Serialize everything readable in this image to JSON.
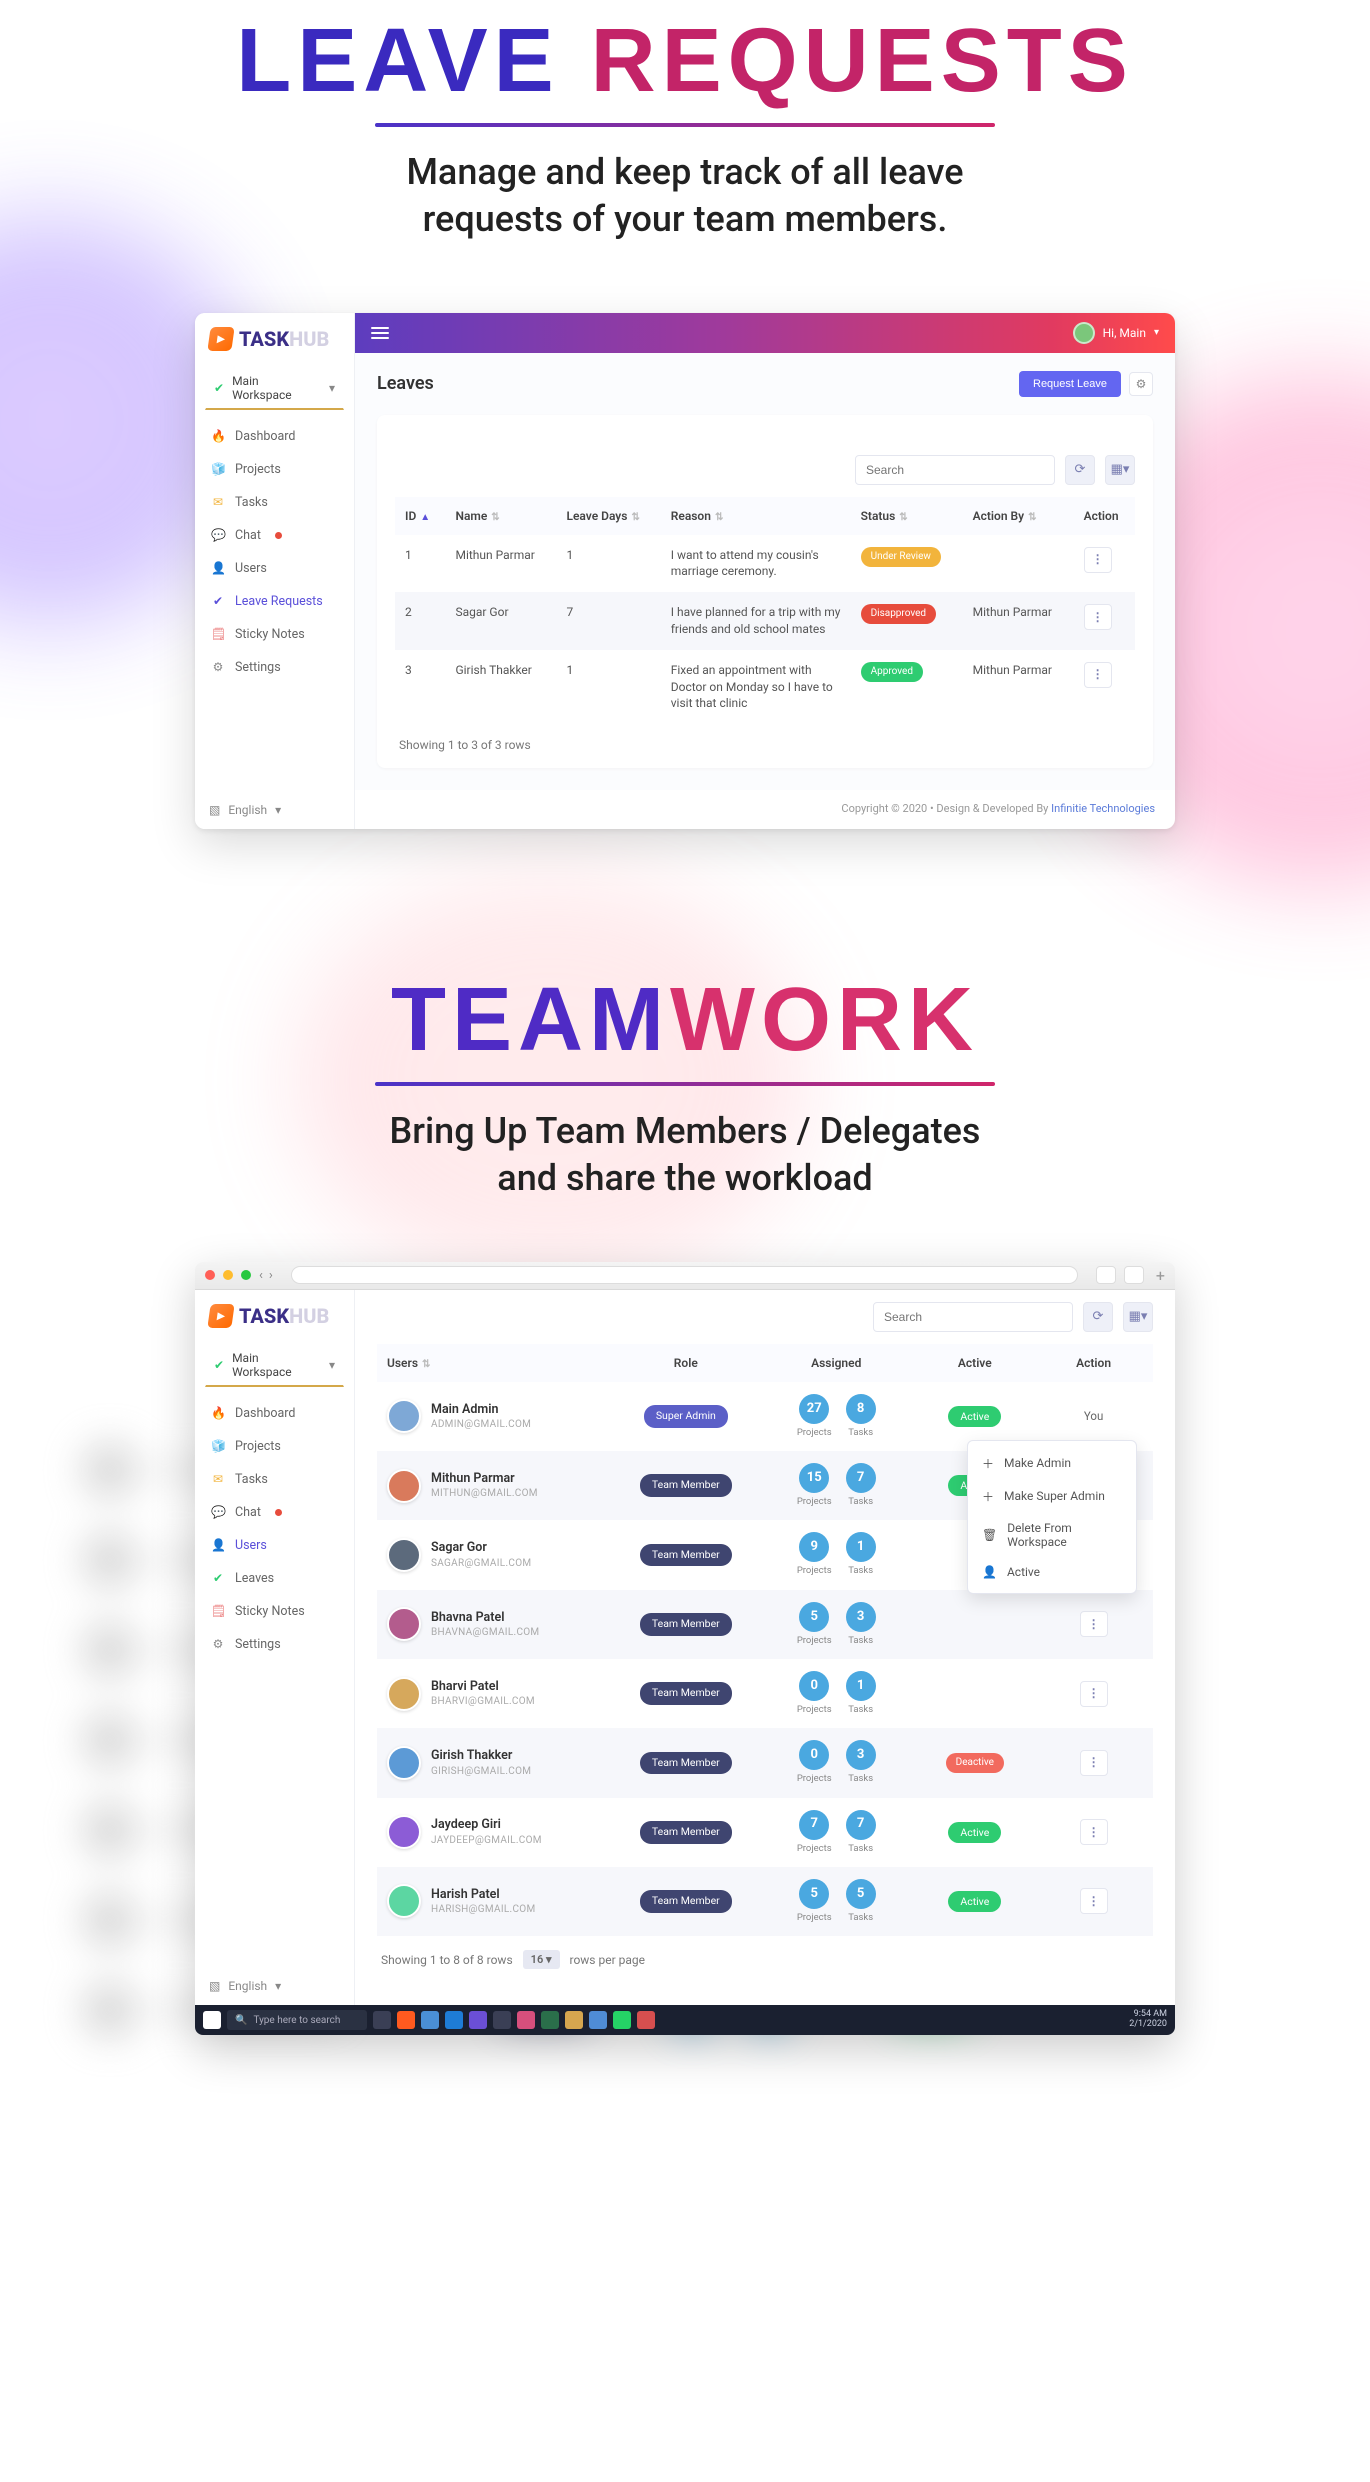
{
  "hero1": {
    "part1": "LEAVE ",
    "part2": "REQUESTS",
    "subtitle": "Manage and keep track of all leave requests of your team members."
  },
  "hero2": {
    "part1": "TEAM",
    "part2": "WORK",
    "subtitle": "Bring Up Team Members / Delegates and share the workload"
  },
  "brand": {
    "t1": "TASK",
    "t2": "HUB"
  },
  "workspace": {
    "label": "Main Workspace"
  },
  "sidebar": {
    "items": [
      {
        "icon": "🔥",
        "label": "Dashboard",
        "color": "#f26a5e"
      },
      {
        "icon": "🧊",
        "label": "Projects",
        "color": "#4aa8e0"
      },
      {
        "icon": "✉",
        "label": "Tasks",
        "color": "#f2b43c"
      },
      {
        "icon": "💬",
        "label": "Chat",
        "color": "#2ecc71",
        "dot": true
      },
      {
        "icon": "👤",
        "label": "Users",
        "color": "#e48bb4"
      },
      {
        "icon": "✔",
        "label": "Leave Requests",
        "color": "#5a4fd9"
      },
      {
        "icon": "🗒",
        "label": "Sticky Notes",
        "color": "#e97070"
      },
      {
        "icon": "⚙",
        "label": "Settings",
        "color": "#888"
      }
    ]
  },
  "sidebar2": {
    "items": [
      {
        "icon": "🔥",
        "label": "Dashboard",
        "color": "#f26a5e"
      },
      {
        "icon": "🧊",
        "label": "Projects",
        "color": "#4aa8e0"
      },
      {
        "icon": "✉",
        "label": "Tasks",
        "color": "#f2b43c"
      },
      {
        "icon": "💬",
        "label": "Chat",
        "color": "#2ecc71",
        "dot": true
      },
      {
        "icon": "👤",
        "label": "Users",
        "color": "#5a4fd9"
      },
      {
        "icon": "✔",
        "label": "Leaves",
        "color": "#2ecc71"
      },
      {
        "icon": "🗒",
        "label": "Sticky Notes",
        "color": "#e97070"
      },
      {
        "icon": "⚙",
        "label": "Settings",
        "color": "#888"
      }
    ]
  },
  "lang": {
    "label": "English"
  },
  "topbar": {
    "greeting": "Hi, Main"
  },
  "leaves": {
    "title": "Leaves",
    "request_btn": "Request Leave",
    "search_placeholder": "Search",
    "headers": {
      "id": "ID",
      "name": "Name",
      "days": "Leave Days",
      "reason": "Reason",
      "status": "Status",
      "action_by": "Action By",
      "action": "Action"
    },
    "rows": [
      {
        "id": "1",
        "name": "Mithun Parmar",
        "days": "1",
        "reason": "I want to attend my cousin's marriage ceremony.",
        "status": "Under Review",
        "status_cls": "b-review",
        "action_by": ""
      },
      {
        "id": "2",
        "name": "Sagar Gor",
        "days": "7",
        "reason": "I have planned for a trip with my friends and old school mates",
        "status": "Disapproved",
        "status_cls": "b-disapp",
        "action_by": "Mithun Parmar"
      },
      {
        "id": "3",
        "name": "Girish Thakker",
        "days": "1",
        "reason": "Fixed an appointment with Doctor on Monday so I have to visit that clinic",
        "status": "Approved",
        "status_cls": "b-appr",
        "action_by": "Mithun Parmar"
      }
    ],
    "footer": "Showing 1 to 3 of 3 rows"
  },
  "copyright": {
    "text": "Copyright © 2020  •  Design & Developed By ",
    "link": "Infinitie Technologies"
  },
  "users": {
    "search_placeholder": "Search",
    "headers": {
      "users": "Users",
      "role": "Role",
      "assigned": "Assigned",
      "active": "Active",
      "action": "Action"
    },
    "count_labels": {
      "projects": "Projects",
      "tasks": "Tasks"
    },
    "you": "You",
    "rows": [
      {
        "name": "Main Admin",
        "email": "ADMIN@GMAIL.COM",
        "role": "Super Admin",
        "role_sa": true,
        "projects": "27",
        "tasks": "8",
        "active": "Active",
        "active_cls": "active-pill",
        "you": true
      },
      {
        "name": "Mithun Parmar",
        "email": "MITHUN@GMAIL.COM",
        "role": "Team Member",
        "projects": "15",
        "tasks": "7",
        "active": "Active",
        "active_cls": "active-pill"
      },
      {
        "name": "Sagar Gor",
        "email": "SAGAR@GMAIL.COM",
        "role": "Team Member",
        "projects": "9",
        "tasks": "1",
        "active": "",
        "active_cls": ""
      },
      {
        "name": "Bhavna Patel",
        "email": "BHAVNA@GMAIL.COM",
        "role": "Team Member",
        "projects": "5",
        "tasks": "3",
        "active": "",
        "active_cls": ""
      },
      {
        "name": "Bharvi Patel",
        "email": "BHARVI@GMAIL.COM",
        "role": "Team Member",
        "projects": "0",
        "tasks": "1",
        "active": "",
        "active_cls": ""
      },
      {
        "name": "Girish Thakker",
        "email": "GIRISH@GMAIL.COM",
        "role": "Team Member",
        "projects": "0",
        "tasks": "3",
        "active": "Deactive",
        "active_cls": "badge b-deact"
      },
      {
        "name": "Jaydeep Giri",
        "email": "JAYDEEP@GMAIL.COM",
        "role": "Team Member",
        "projects": "7",
        "tasks": "7",
        "active": "Active",
        "active_cls": "active-pill"
      },
      {
        "name": "Harish Patel",
        "email": "HARISH@GMAIL.COM",
        "role": "Team Member",
        "projects": "5",
        "tasks": "5",
        "active": "Active",
        "active_cls": "active-pill"
      }
    ],
    "footer": "Showing 1 to 8 of 8 rows",
    "per_page": "16",
    "per_page_suffix": "rows per page",
    "popover": [
      {
        "icon": "＋",
        "label": "Make Admin"
      },
      {
        "icon": "＋",
        "label": "Make Super Admin"
      },
      {
        "icon": "🗑",
        "label": "Delete From Workspace"
      },
      {
        "icon": "👤",
        "label": "Active"
      }
    ]
  },
  "taskbar": {
    "search": "Type here to search",
    "time": "9:54 AM",
    "date": "2/1/2020"
  }
}
